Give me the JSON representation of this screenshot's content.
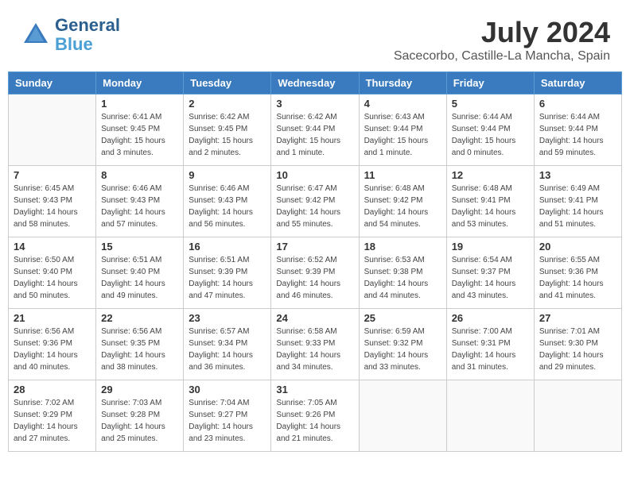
{
  "logo": {
    "line1": "General",
    "line2": "Blue"
  },
  "title": "July 2024",
  "subtitle": "Sacecorbo, Castille-La Mancha, Spain",
  "days_of_week": [
    "Sunday",
    "Monday",
    "Tuesday",
    "Wednesday",
    "Thursday",
    "Friday",
    "Saturday"
  ],
  "weeks": [
    [
      {
        "day": "",
        "info": ""
      },
      {
        "day": "1",
        "info": "Sunrise: 6:41 AM\nSunset: 9:45 PM\nDaylight: 15 hours\nand 3 minutes."
      },
      {
        "day": "2",
        "info": "Sunrise: 6:42 AM\nSunset: 9:45 PM\nDaylight: 15 hours\nand 2 minutes."
      },
      {
        "day": "3",
        "info": "Sunrise: 6:42 AM\nSunset: 9:44 PM\nDaylight: 15 hours\nand 1 minute."
      },
      {
        "day": "4",
        "info": "Sunrise: 6:43 AM\nSunset: 9:44 PM\nDaylight: 15 hours\nand 1 minute."
      },
      {
        "day": "5",
        "info": "Sunrise: 6:44 AM\nSunset: 9:44 PM\nDaylight: 15 hours\nand 0 minutes."
      },
      {
        "day": "6",
        "info": "Sunrise: 6:44 AM\nSunset: 9:44 PM\nDaylight: 14 hours\nand 59 minutes."
      }
    ],
    [
      {
        "day": "7",
        "info": "Sunrise: 6:45 AM\nSunset: 9:43 PM\nDaylight: 14 hours\nand 58 minutes."
      },
      {
        "day": "8",
        "info": "Sunrise: 6:46 AM\nSunset: 9:43 PM\nDaylight: 14 hours\nand 57 minutes."
      },
      {
        "day": "9",
        "info": "Sunrise: 6:46 AM\nSunset: 9:43 PM\nDaylight: 14 hours\nand 56 minutes."
      },
      {
        "day": "10",
        "info": "Sunrise: 6:47 AM\nSunset: 9:42 PM\nDaylight: 14 hours\nand 55 minutes."
      },
      {
        "day": "11",
        "info": "Sunrise: 6:48 AM\nSunset: 9:42 PM\nDaylight: 14 hours\nand 54 minutes."
      },
      {
        "day": "12",
        "info": "Sunrise: 6:48 AM\nSunset: 9:41 PM\nDaylight: 14 hours\nand 53 minutes."
      },
      {
        "day": "13",
        "info": "Sunrise: 6:49 AM\nSunset: 9:41 PM\nDaylight: 14 hours\nand 51 minutes."
      }
    ],
    [
      {
        "day": "14",
        "info": "Sunrise: 6:50 AM\nSunset: 9:40 PM\nDaylight: 14 hours\nand 50 minutes."
      },
      {
        "day": "15",
        "info": "Sunrise: 6:51 AM\nSunset: 9:40 PM\nDaylight: 14 hours\nand 49 minutes."
      },
      {
        "day": "16",
        "info": "Sunrise: 6:51 AM\nSunset: 9:39 PM\nDaylight: 14 hours\nand 47 minutes."
      },
      {
        "day": "17",
        "info": "Sunrise: 6:52 AM\nSunset: 9:39 PM\nDaylight: 14 hours\nand 46 minutes."
      },
      {
        "day": "18",
        "info": "Sunrise: 6:53 AM\nSunset: 9:38 PM\nDaylight: 14 hours\nand 44 minutes."
      },
      {
        "day": "19",
        "info": "Sunrise: 6:54 AM\nSunset: 9:37 PM\nDaylight: 14 hours\nand 43 minutes."
      },
      {
        "day": "20",
        "info": "Sunrise: 6:55 AM\nSunset: 9:36 PM\nDaylight: 14 hours\nand 41 minutes."
      }
    ],
    [
      {
        "day": "21",
        "info": "Sunrise: 6:56 AM\nSunset: 9:36 PM\nDaylight: 14 hours\nand 40 minutes."
      },
      {
        "day": "22",
        "info": "Sunrise: 6:56 AM\nSunset: 9:35 PM\nDaylight: 14 hours\nand 38 minutes."
      },
      {
        "day": "23",
        "info": "Sunrise: 6:57 AM\nSunset: 9:34 PM\nDaylight: 14 hours\nand 36 minutes."
      },
      {
        "day": "24",
        "info": "Sunrise: 6:58 AM\nSunset: 9:33 PM\nDaylight: 14 hours\nand 34 minutes."
      },
      {
        "day": "25",
        "info": "Sunrise: 6:59 AM\nSunset: 9:32 PM\nDaylight: 14 hours\nand 33 minutes."
      },
      {
        "day": "26",
        "info": "Sunrise: 7:00 AM\nSunset: 9:31 PM\nDaylight: 14 hours\nand 31 minutes."
      },
      {
        "day": "27",
        "info": "Sunrise: 7:01 AM\nSunset: 9:30 PM\nDaylight: 14 hours\nand 29 minutes."
      }
    ],
    [
      {
        "day": "28",
        "info": "Sunrise: 7:02 AM\nSunset: 9:29 PM\nDaylight: 14 hours\nand 27 minutes."
      },
      {
        "day": "29",
        "info": "Sunrise: 7:03 AM\nSunset: 9:28 PM\nDaylight: 14 hours\nand 25 minutes."
      },
      {
        "day": "30",
        "info": "Sunrise: 7:04 AM\nSunset: 9:27 PM\nDaylight: 14 hours\nand 23 minutes."
      },
      {
        "day": "31",
        "info": "Sunrise: 7:05 AM\nSunset: 9:26 PM\nDaylight: 14 hours\nand 21 minutes."
      },
      {
        "day": "",
        "info": ""
      },
      {
        "day": "",
        "info": ""
      },
      {
        "day": "",
        "info": ""
      }
    ]
  ]
}
